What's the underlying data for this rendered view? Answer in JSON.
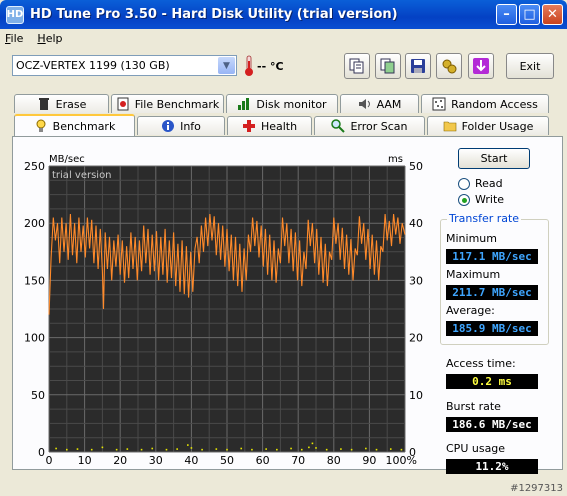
{
  "window": {
    "title": "HD Tune Pro 3.50 - Hard Disk Utility (trial version)",
    "icon_label": "HD"
  },
  "menu": [
    "File",
    "Help"
  ],
  "toolbar": {
    "drive": "OCZ-VERTEX 1199 (130 GB)",
    "temperature": "-- °C",
    "exit_label": "Exit",
    "buttons": [
      "copy-text-icon",
      "copy-screenshot-icon",
      "save-icon",
      "options-icon",
      "download-icon"
    ]
  },
  "tabs_top": [
    {
      "label": "Erase",
      "icon": "trash-icon"
    },
    {
      "label": "File Benchmark",
      "icon": "file-benchmark-icon"
    },
    {
      "label": "Disk monitor",
      "icon": "disk-monitor-icon"
    },
    {
      "label": "AAM",
      "icon": "speaker-icon"
    },
    {
      "label": "Random Access",
      "icon": "random-access-icon"
    }
  ],
  "tabs_bottom": [
    {
      "label": "Benchmark",
      "icon": "benchmark-bulb-icon",
      "active": true
    },
    {
      "label": "Info",
      "icon": "info-icon"
    },
    {
      "label": "Health",
      "icon": "health-cross-icon"
    },
    {
      "label": "Error Scan",
      "icon": "magnifier-icon"
    },
    {
      "label": "Folder Usage",
      "icon": "folder-icon"
    }
  ],
  "controls": {
    "start_label": "Start",
    "read_label": "Read",
    "write_label": "Write",
    "selected_mode": "Write"
  },
  "stats": {
    "transfer_rate_title": "Transfer rate",
    "minimum_label": "Minimum",
    "minimum_value": "117.1 MB/sec",
    "maximum_label": "Maximum",
    "maximum_value": "211.7 MB/sec",
    "average_label": "Average:",
    "average_value": "185.9 MB/sec",
    "access_label": "Access time:",
    "access_value": "0.2 ms",
    "burst_label": "Burst rate",
    "burst_value": "186.6 MB/sec",
    "cpu_label": "CPU usage",
    "cpu_value": "11.2%"
  },
  "watermark": "#1297313",
  "chart_data": {
    "type": "line",
    "overlay_text": "trial version",
    "y_left_unit": "MB/sec",
    "y_right_unit": "ms",
    "y_left_ticks": [
      0,
      50,
      100,
      150,
      200,
      250
    ],
    "y_right_ticks": [
      0,
      10,
      20,
      30,
      40,
      50
    ],
    "x_ticks": [
      "0",
      "10",
      "20",
      "30",
      "40",
      "50",
      "60",
      "70",
      "80",
      "90",
      "100%"
    ],
    "ylim": [
      0,
      250
    ],
    "y2lim": [
      0,
      50
    ],
    "xlim": [
      0,
      100
    ],
    "grid": true,
    "line_color": "#ff8a2a",
    "dot_color": "#e8e800",
    "series": [
      {
        "values": [
          {
            "x": 0,
            "y": 120
          },
          {
            "x": 0.6,
            "y": 170
          },
          {
            "x": 1.2,
            "y": 205
          },
          {
            "x": 1.8,
            "y": 185
          },
          {
            "x": 2.4,
            "y": 200
          },
          {
            "x": 3,
            "y": 165
          },
          {
            "x": 3.6,
            "y": 205
          },
          {
            "x": 4.2,
            "y": 175
          },
          {
            "x": 4.8,
            "y": 200
          },
          {
            "x": 5.4,
            "y": 168
          },
          {
            "x": 6,
            "y": 208
          },
          {
            "x": 6.6,
            "y": 172
          },
          {
            "x": 7.2,
            "y": 200
          },
          {
            "x": 7.8,
            "y": 165
          },
          {
            "x": 8.4,
            "y": 205
          },
          {
            "x": 9,
            "y": 175
          },
          {
            "x": 9.6,
            "y": 198
          },
          {
            "x": 10.2,
            "y": 170
          },
          {
            "x": 10.8,
            "y": 205
          },
          {
            "x": 11.4,
            "y": 178
          },
          {
            "x": 12,
            "y": 203
          },
          {
            "x": 12.6,
            "y": 165
          },
          {
            "x": 13.2,
            "y": 198
          },
          {
            "x": 13.8,
            "y": 160
          },
          {
            "x": 14.4,
            "y": 195
          },
          {
            "x": 15,
            "y": 158
          },
          {
            "x": 15.3,
            "y": 125
          },
          {
            "x": 15.8,
            "y": 192
          },
          {
            "x": 16.4,
            "y": 160
          },
          {
            "x": 17,
            "y": 188
          },
          {
            "x": 17.6,
            "y": 150
          },
          {
            "x": 18.2,
            "y": 185
          },
          {
            "x": 18.8,
            "y": 162
          },
          {
            "x": 19.4,
            "y": 190
          },
          {
            "x": 20,
            "y": 155
          },
          {
            "x": 20.6,
            "y": 185
          },
          {
            "x": 21.2,
            "y": 148
          },
          {
            "x": 21.8,
            "y": 180
          },
          {
            "x": 22.4,
            "y": 152
          },
          {
            "x": 23,
            "y": 192
          },
          {
            "x": 23.6,
            "y": 160
          },
          {
            "x": 24.2,
            "y": 188
          },
          {
            "x": 24.8,
            "y": 150
          },
          {
            "x": 25.4,
            "y": 185
          },
          {
            "x": 26,
            "y": 158
          },
          {
            "x": 26.6,
            "y": 198
          },
          {
            "x": 27.2,
            "y": 165
          },
          {
            "x": 27.8,
            "y": 195
          },
          {
            "x": 28.4,
            "y": 155
          },
          {
            "x": 29,
            "y": 190
          },
          {
            "x": 29.6,
            "y": 158
          },
          {
            "x": 30.2,
            "y": 193
          },
          {
            "x": 30.8,
            "y": 150
          },
          {
            "x": 31.4,
            "y": 188
          },
          {
            "x": 32,
            "y": 155
          },
          {
            "x": 32.6,
            "y": 195
          },
          {
            "x": 33.2,
            "y": 148
          },
          {
            "x": 33.8,
            "y": 185
          },
          {
            "x": 34.4,
            "y": 152
          },
          {
            "x": 35,
            "y": 192
          },
          {
            "x": 35.6,
            "y": 145
          },
          {
            "x": 36.2,
            "y": 182
          },
          {
            "x": 36.8,
            "y": 140
          },
          {
            "x": 37.4,
            "y": 185
          },
          {
            "x": 38,
            "y": 138
          },
          {
            "x": 38.6,
            "y": 180
          },
          {
            "x": 39.2,
            "y": 135
          },
          {
            "x": 39.8,
            "y": 175
          },
          {
            "x": 40.4,
            "y": 140
          },
          {
            "x": 41,
            "y": 178
          },
          {
            "x": 41.6,
            "y": 188
          },
          {
            "x": 42.2,
            "y": 165
          },
          {
            "x": 42.8,
            "y": 198
          },
          {
            "x": 43.4,
            "y": 175
          },
          {
            "x": 44,
            "y": 205
          },
          {
            "x": 44.6,
            "y": 180
          },
          {
            "x": 45.2,
            "y": 208
          },
          {
            "x": 45.8,
            "y": 185
          },
          {
            "x": 46.4,
            "y": 206
          },
          {
            "x": 47,
            "y": 172
          },
          {
            "x": 47.6,
            "y": 200
          },
          {
            "x": 48.2,
            "y": 168
          },
          {
            "x": 48.8,
            "y": 198
          },
          {
            "x": 49.4,
            "y": 162
          },
          {
            "x": 50,
            "y": 195
          },
          {
            "x": 50.6,
            "y": 158
          },
          {
            "x": 51.2,
            "y": 190
          },
          {
            "x": 51.8,
            "y": 150
          },
          {
            "x": 52.4,
            "y": 188
          },
          {
            "x": 53,
            "y": 145
          },
          {
            "x": 53.6,
            "y": 182
          },
          {
            "x": 54.2,
            "y": 140
          },
          {
            "x": 54.8,
            "y": 178
          },
          {
            "x": 55.4,
            "y": 150
          },
          {
            "x": 56,
            "y": 190
          },
          {
            "x": 56.6,
            "y": 175
          },
          {
            "x": 57.2,
            "y": 205
          },
          {
            "x": 57.8,
            "y": 180
          },
          {
            "x": 58.4,
            "y": 202
          },
          {
            "x": 59,
            "y": 170
          },
          {
            "x": 59.6,
            "y": 198
          },
          {
            "x": 60.2,
            "y": 162
          },
          {
            "x": 60.8,
            "y": 195
          },
          {
            "x": 61.4,
            "y": 155
          },
          {
            "x": 62,
            "y": 190
          },
          {
            "x": 62.6,
            "y": 150
          },
          {
            "x": 63.2,
            "y": 185
          },
          {
            "x": 63.8,
            "y": 148
          },
          {
            "x": 64.4,
            "y": 178
          },
          {
            "x": 65,
            "y": 165
          },
          {
            "x": 65.6,
            "y": 205
          },
          {
            "x": 66.2,
            "y": 180
          },
          {
            "x": 66.8,
            "y": 200
          },
          {
            "x": 67.4,
            "y": 165
          },
          {
            "x": 68,
            "y": 195
          },
          {
            "x": 68.6,
            "y": 158
          },
          {
            "x": 69.2,
            "y": 192
          },
          {
            "x": 69.8,
            "y": 150
          },
          {
            "x": 70.4,
            "y": 185
          },
          {
            "x": 71,
            "y": 145
          },
          {
            "x": 71.6,
            "y": 175
          },
          {
            "x": 72.2,
            "y": 160
          },
          {
            "x": 72.8,
            "y": 203
          },
          {
            "x": 73.4,
            "y": 180
          },
          {
            "x": 74,
            "y": 200
          },
          {
            "x": 74.6,
            "y": 165
          },
          {
            "x": 75.2,
            "y": 195
          },
          {
            "x": 75.8,
            "y": 155
          },
          {
            "x": 76.4,
            "y": 188
          },
          {
            "x": 77,
            "y": 148
          },
          {
            "x": 77.6,
            "y": 182
          },
          {
            "x": 78.2,
            "y": 145
          },
          {
            "x": 78.8,
            "y": 175
          },
          {
            "x": 79.4,
            "y": 168
          },
          {
            "x": 80,
            "y": 205
          },
          {
            "x": 80.6,
            "y": 182
          },
          {
            "x": 81.2,
            "y": 200
          },
          {
            "x": 81.8,
            "y": 168
          },
          {
            "x": 82.4,
            "y": 196
          },
          {
            "x": 83,
            "y": 160
          },
          {
            "x": 83.6,
            "y": 190
          },
          {
            "x": 84.2,
            "y": 155
          },
          {
            "x": 84.8,
            "y": 186
          },
          {
            "x": 85.4,
            "y": 150
          },
          {
            "x": 86,
            "y": 178
          },
          {
            "x": 86.6,
            "y": 172
          },
          {
            "x": 87.2,
            "y": 206
          },
          {
            "x": 87.8,
            "y": 182
          },
          {
            "x": 88.4,
            "y": 200
          },
          {
            "x": 89,
            "y": 168
          },
          {
            "x": 89.6,
            "y": 195
          },
          {
            "x": 90.2,
            "y": 160
          },
          {
            "x": 90.8,
            "y": 190
          },
          {
            "x": 91.4,
            "y": 155
          },
          {
            "x": 92,
            "y": 185
          },
          {
            "x": 92.6,
            "y": 150
          },
          {
            "x": 93.2,
            "y": 180
          },
          {
            "x": 93.8,
            "y": 175
          },
          {
            "x": 94.4,
            "y": 208
          },
          {
            "x": 95,
            "y": 185
          },
          {
            "x": 95.6,
            "y": 202
          },
          {
            "x": 96.2,
            "y": 180
          },
          {
            "x": 96.8,
            "y": 208
          },
          {
            "x": 97.4,
            "y": 190
          },
          {
            "x": 98,
            "y": 205
          },
          {
            "x": 98.6,
            "y": 182
          },
          {
            "x": 99.2,
            "y": 200
          },
          {
            "x": 100,
            "y": 190
          }
        ]
      },
      {
        "axis": "right",
        "values": [
          {
            "x": 2,
            "y": 0.4
          },
          {
            "x": 5,
            "y": 0.2
          },
          {
            "x": 8,
            "y": 0.3
          },
          {
            "x": 12,
            "y": 0.2
          },
          {
            "x": 15,
            "y": 0.6
          },
          {
            "x": 19,
            "y": 0.2
          },
          {
            "x": 22,
            "y": 0.3
          },
          {
            "x": 26,
            "y": 0.2
          },
          {
            "x": 29,
            "y": 0.4
          },
          {
            "x": 33,
            "y": 0.2
          },
          {
            "x": 36,
            "y": 0.3
          },
          {
            "x": 39,
            "y": 1.0
          },
          {
            "x": 40,
            "y": 0.5
          },
          {
            "x": 43,
            "y": 0.2
          },
          {
            "x": 47,
            "y": 0.3
          },
          {
            "x": 50,
            "y": 0.2
          },
          {
            "x": 54,
            "y": 0.4
          },
          {
            "x": 57,
            "y": 0.2
          },
          {
            "x": 61,
            "y": 0.3
          },
          {
            "x": 64,
            "y": 0.2
          },
          {
            "x": 68,
            "y": 0.4
          },
          {
            "x": 71,
            "y": 0.2
          },
          {
            "x": 73,
            "y": 0.6
          },
          {
            "x": 74,
            "y": 1.3
          },
          {
            "x": 75,
            "y": 0.5
          },
          {
            "x": 78,
            "y": 0.2
          },
          {
            "x": 82,
            "y": 0.3
          },
          {
            "x": 85,
            "y": 0.2
          },
          {
            "x": 89,
            "y": 0.4
          },
          {
            "x": 92,
            "y": 0.2
          },
          {
            "x": 96,
            "y": 0.3
          },
          {
            "x": 99,
            "y": 0.2
          }
        ]
      }
    ]
  }
}
